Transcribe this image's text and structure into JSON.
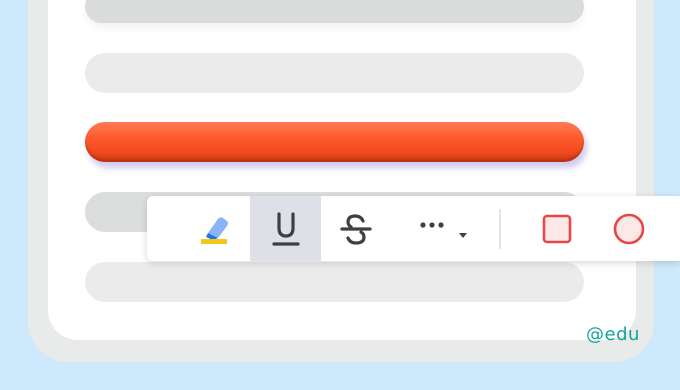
{
  "document": {
    "lines": [
      {
        "state": "default"
      },
      {
        "state": "default"
      },
      {
        "state": "selected",
        "color": "#ff5a2c"
      },
      {
        "state": "default"
      },
      {
        "state": "default"
      }
    ]
  },
  "toolbar": {
    "tools": [
      {
        "icon": "highlighter-icon",
        "active": false,
        "color": "#f5c518"
      },
      {
        "icon": "underline-icon",
        "active": true
      },
      {
        "icon": "strikethrough-icon",
        "active": false
      },
      {
        "icon": "more-options-icon",
        "active": false,
        "has_dropdown": true
      },
      {
        "icon": "square-shape-icon",
        "active": false,
        "color": "#e8474a"
      },
      {
        "icon": "circle-shape-icon",
        "active": false,
        "color": "#e8474a"
      }
    ]
  },
  "watermark": "@edu"
}
